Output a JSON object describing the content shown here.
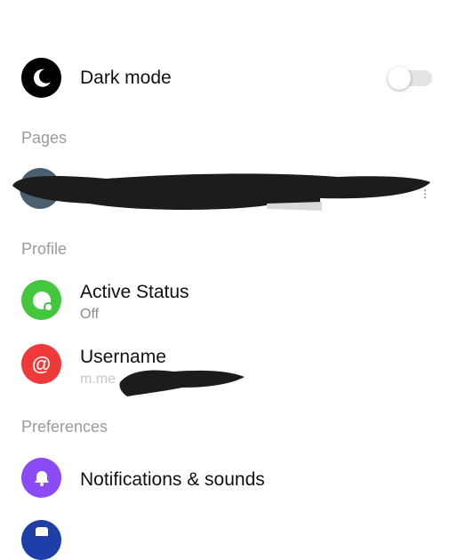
{
  "dark_mode": {
    "label": "Dark mode",
    "enabled": false,
    "icon": "moon-icon",
    "icon_bg": "#000000"
  },
  "sections": {
    "pages": "Pages",
    "profile": "Profile",
    "preferences": "Preferences"
  },
  "profile": {
    "active_status": {
      "label": "Active Status",
      "value": "Off",
      "icon": "active-status-icon",
      "icon_bg": "#44c63f"
    },
    "username": {
      "label": "Username",
      "value_prefix": "m.me",
      "icon": "at-icon",
      "icon_bg": "#f03a3a"
    }
  },
  "preferences": {
    "notifications": {
      "label": "Notifications & sounds",
      "icon": "bell-icon",
      "icon_bg": "#8b4cf6"
    }
  },
  "colors": {
    "section_text": "#9b9b9b",
    "secondary_text": "#8a8a8a",
    "redaction": "#1a1a1a"
  }
}
